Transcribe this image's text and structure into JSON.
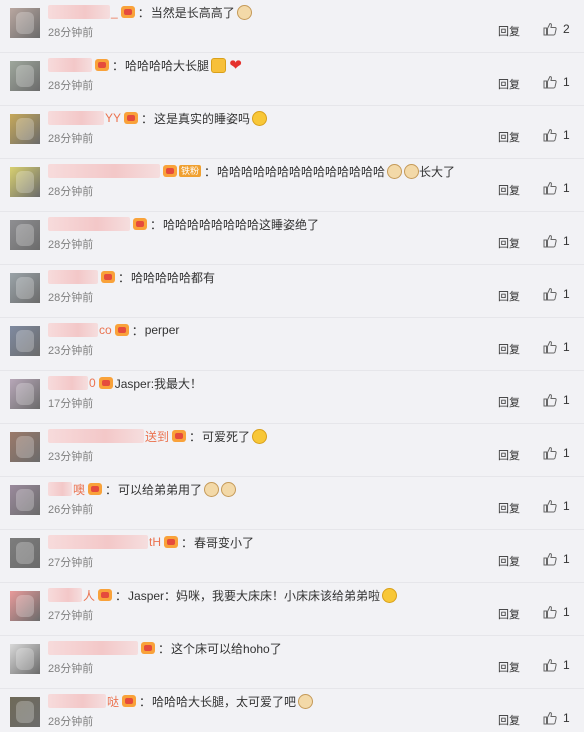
{
  "labels": {
    "reply": "回复"
  },
  "comments": [
    {
      "name_tail": "_",
      "text": "当然是长高高了",
      "emoji": [
        "cat"
      ],
      "time": "28分钟前",
      "likes": "2",
      "avatar": "#b9a7a0",
      "blur_w": 62
    },
    {
      "name_tail": "",
      "text": "哈哈哈哈大长腿",
      "emoji": [
        "crown",
        "heart"
      ],
      "time": "28分钟前",
      "likes": "1",
      "avatar": "#9ea79c",
      "blur_w": 44
    },
    {
      "name_tail": "YY",
      "text": "这是真实的睡姿吗",
      "emoji": [
        "face"
      ],
      "time": "28分钟前",
      "likes": "1",
      "avatar": "#c6a85a",
      "blur_w": 56
    },
    {
      "name_tail": "",
      "badge": "铁粉",
      "text": "哈哈哈哈哈哈哈哈哈哈哈哈哈哈",
      "emoji": [
        "cat",
        "cat"
      ],
      "text2": "长大了",
      "time": "28分钟前",
      "likes": "1",
      "avatar": "#d8d070",
      "blur_w": 112
    },
    {
      "name_tail": "",
      "text": "哈哈哈哈哈哈哈哈这睡姿绝了",
      "emoji": [],
      "time": "28分钟前",
      "likes": "1",
      "avatar": "#8f8f92",
      "blur_w": 82
    },
    {
      "name_tail": "",
      "text": "哈哈哈哈哈都有",
      "emoji": [],
      "time": "28分钟前",
      "likes": "1",
      "avatar": "#9aa3a8",
      "blur_w": 50
    },
    {
      "name_tail": "co",
      "text": "perper",
      "emoji": [],
      "time": "23分钟前",
      "likes": "1",
      "avatar": "#7f8aa0",
      "blur_w": 50
    },
    {
      "name_tail": "0",
      "text": "Jasper:我最大！",
      "emoji": [],
      "time": "17分钟前",
      "likes": "1",
      "avatar": "#b7a7b8",
      "blur_w": 40,
      "no_colon": true
    },
    {
      "name_tail": "送到",
      "text": "可爱死了",
      "emoji": [
        "face"
      ],
      "time": "23分钟前",
      "likes": "1",
      "avatar": "#9b7a6a",
      "blur_w": 96
    },
    {
      "name_tail": "噢",
      "text": "可以给弟弟用了",
      "emoji": [
        "cat",
        "cat"
      ],
      "time": "26分钟前",
      "likes": "1",
      "avatar": "#9a8a9c",
      "blur_w": 24
    },
    {
      "name_tail": "tH",
      "text": "春哥变小了",
      "emoji": [],
      "time": "27分钟前",
      "likes": "1",
      "avatar": "#7d7d7d",
      "blur_w": 100
    },
    {
      "name_tail": "人",
      "text": "Jasper：妈咪，我要大床床！小床床该给弟弟啦",
      "emoji": [
        "face"
      ],
      "time": "27分钟前",
      "likes": "1",
      "avatar": "#e89a9a",
      "blur_w": 34
    },
    {
      "name_tail": "",
      "text": "这个床可以给hoho了",
      "emoji": [],
      "time": "28分钟前",
      "likes": "1",
      "avatar": "#d8d8d8",
      "blur_w": 90
    },
    {
      "name_tail": "哒",
      "text": "哈哈哈大长腿，太可爱了吧",
      "emoji": [
        "cat"
      ],
      "time": "28分钟前",
      "likes": "1",
      "avatar": "#6f6a58",
      "blur_w": 58
    }
  ]
}
